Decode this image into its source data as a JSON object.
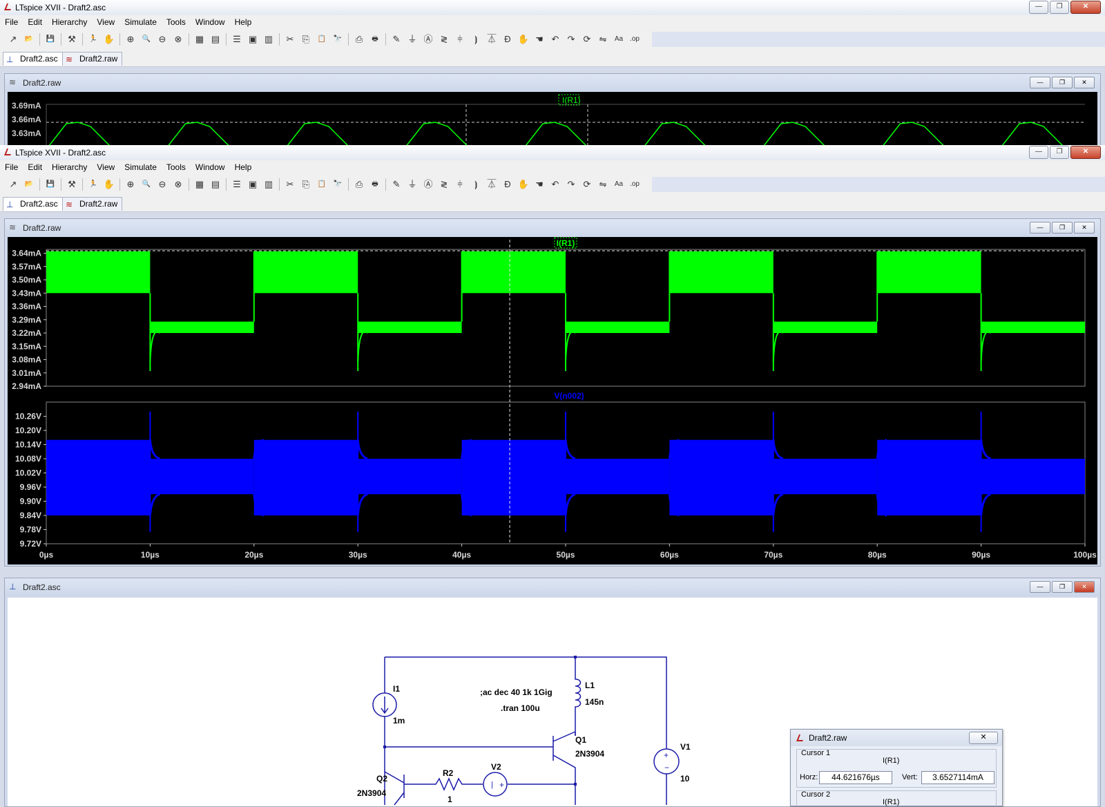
{
  "app": {
    "window_title_back": "LTspice XVII - Draft2.asc",
    "window_title_front": "LTspice XVII - Draft2.asc",
    "minimize": "—",
    "maximize": "❐",
    "close": "✕"
  },
  "menu": [
    "File",
    "Edit",
    "Hierarchy",
    "View",
    "Simulate",
    "Tools",
    "Window",
    "Help"
  ],
  "tabs": [
    {
      "label": "Draft2.asc",
      "icon": "schematic-icon"
    },
    {
      "label": "Draft2.raw",
      "icon": "waveform-icon"
    }
  ],
  "back_plot": {
    "title": "Draft2.raw",
    "trace_label": "I(R1)",
    "y_ticks": [
      "3.69mA",
      "3.66mA",
      "3.63mA"
    ]
  },
  "plot_window": {
    "title": "Draft2.raw",
    "traces": [
      {
        "label": "I(R1)",
        "color": "#00ff00"
      },
      {
        "label": "V(n002)",
        "color": "#0000ff"
      }
    ]
  },
  "chart_data": [
    {
      "type": "line",
      "series": [
        {
          "name": "I(R1)",
          "color": "#00ff00"
        }
      ],
      "y_ticks": [
        "3.64mA",
        "3.57mA",
        "3.50mA",
        "3.43mA",
        "3.36mA",
        "3.29mA",
        "3.22mA",
        "3.15mA",
        "3.08mA",
        "3.01mA",
        "2.94mA"
      ],
      "ylim": [
        2.94,
        3.66
      ],
      "x_ticks": [
        "0µs",
        "10µs",
        "20µs",
        "30µs",
        "40µs",
        "50µs",
        "60µs",
        "70µs",
        "80µs",
        "90µs",
        "100µs"
      ],
      "xlim": [
        0,
        100
      ],
      "high_band": [
        3.43,
        3.65
      ],
      "low_band": [
        3.22,
        3.28
      ],
      "high_intervals": [
        [
          0,
          10
        ],
        [
          20,
          30
        ],
        [
          40,
          50
        ],
        [
          60,
          70
        ],
        [
          80,
          90
        ]
      ],
      "low_intervals": [
        [
          10,
          20
        ],
        [
          30,
          40
        ],
        [
          50,
          60
        ],
        [
          70,
          80
        ],
        [
          90,
          100
        ]
      ],
      "cursor_y": 3.6527,
      "cursor_x": 44.62
    },
    {
      "type": "line",
      "series": [
        {
          "name": "V(n002)",
          "color": "#0000ff"
        }
      ],
      "y_ticks": [
        "10.26V",
        "10.20V",
        "10.14V",
        "10.08V",
        "10.02V",
        "9.96V",
        "9.90V",
        "9.84V",
        "9.78V",
        "9.72V"
      ],
      "ylim": [
        9.72,
        10.32
      ],
      "x_ticks": [
        "0µs",
        "10µs",
        "20µs",
        "30µs",
        "40µs",
        "50µs",
        "60µs",
        "70µs",
        "80µs",
        "90µs",
        "100µs"
      ],
      "xlim": [
        0,
        100
      ],
      "wide_band": [
        9.84,
        10.16
      ],
      "narrow_band": [
        9.93,
        10.08
      ],
      "wide_intervals": [
        [
          0,
          10
        ],
        [
          20,
          30
        ],
        [
          40,
          50
        ],
        [
          60,
          70
        ],
        [
          80,
          90
        ]
      ],
      "narrow_intervals": [
        [
          10,
          20
        ],
        [
          30,
          40
        ],
        [
          50,
          60
        ],
        [
          70,
          80
        ],
        [
          90,
          100
        ]
      ],
      "cursor_x": 44.62
    }
  ],
  "schematic": {
    "title": "Draft2.asc",
    "directives": [
      ";ac dec 40 1k 1Gig",
      ".tran 100u"
    ],
    "components": {
      "I1": {
        "name": "I1",
        "value": "1m"
      },
      "L1": {
        "name": "L1",
        "value": "145n"
      },
      "Q1": {
        "name": "Q1",
        "value": "2N3904"
      },
      "Q2": {
        "name": "Q2",
        "value": "2N3904"
      },
      "R2": {
        "name": "R2",
        "value": "1"
      },
      "V2": {
        "name": "V2"
      },
      "V1": {
        "name": "V1",
        "value": "10"
      }
    }
  },
  "cursor_dialog": {
    "title": "Draft2.raw",
    "cursor1": {
      "label": "Cursor 1",
      "trace": "I(R1)",
      "horz_label": "Horz:",
      "horz": "44.621676µs",
      "vert_label": "Vert:",
      "vert": "3.6527114mA"
    },
    "cursor2": {
      "label": "Cursor 2",
      "trace": "I(R1)"
    }
  }
}
